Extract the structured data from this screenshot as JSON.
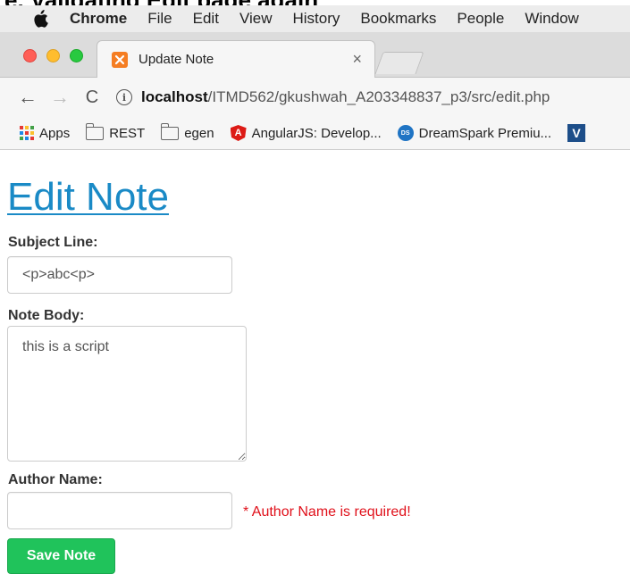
{
  "caption": "e. Validating Edit page again",
  "menubar": {
    "items": [
      "Chrome",
      "File",
      "Edit",
      "View",
      "History",
      "Bookmarks",
      "People",
      "Window"
    ]
  },
  "tab": {
    "title": "Update Note",
    "close_glyph": "×"
  },
  "toolbar": {
    "back_glyph": "←",
    "forward_glyph": "→",
    "reload_glyph": "C",
    "info_glyph": "i",
    "url_host": "localhost",
    "url_path": "/ITMD562/gkushwah_A203348837_p3/src/edit.php"
  },
  "bookmarks": [
    {
      "label": "Apps",
      "icon": "apps-grid-icon"
    },
    {
      "label": "REST",
      "icon": "folder-icon"
    },
    {
      "label": "egen",
      "icon": "folder-icon"
    },
    {
      "label": "AngularJS: Develop...",
      "icon": "angular-icon"
    },
    {
      "label": "DreamSpark Premiu...",
      "icon": "dreamspark-icon"
    }
  ],
  "page": {
    "heading": "Edit Note",
    "subject_label": "Subject Line:",
    "subject_value": "<p>abc<p>",
    "body_label": "Note Body:",
    "body_value": "this is a script",
    "author_label": "Author Name:",
    "author_value": "",
    "author_error": "* Author Name is required!",
    "save_label": "Save Note"
  },
  "colors": {
    "heading": "#1a8ac6",
    "save_button": "#20c35b",
    "error": "#e0101a"
  }
}
